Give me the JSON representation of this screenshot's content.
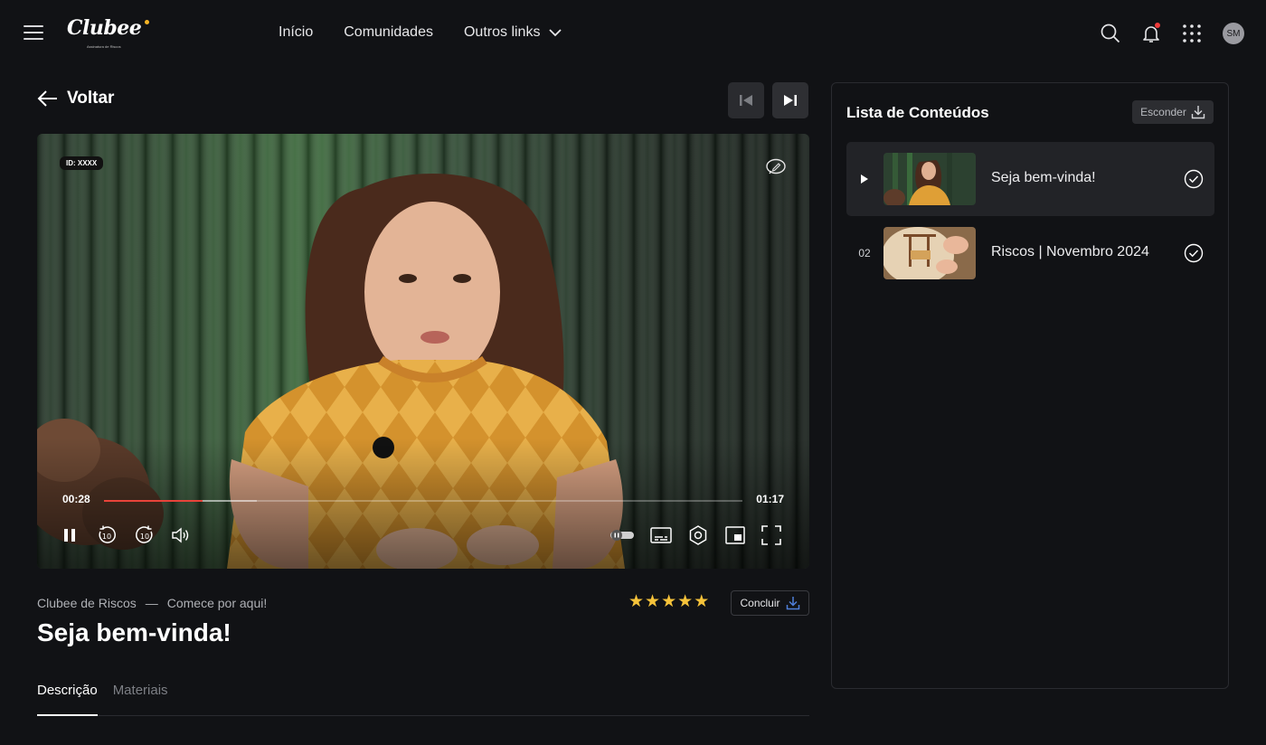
{
  "header": {
    "logo": "Clubee",
    "logo_sub": "Assinatura de Riscos",
    "nav": [
      {
        "label": "Início"
      },
      {
        "label": "Comunidades"
      },
      {
        "label": "Outros links"
      }
    ],
    "avatar_initials": "SM",
    "icons": [
      "search-icon",
      "bell-icon",
      "apps-grid-icon"
    ]
  },
  "back_label": "Voltar",
  "player": {
    "id_tag": "ID: XXXX",
    "current_time": "00:28",
    "total_time": "01:17",
    "progress": 0.155,
    "buffered": 0.24
  },
  "lesson": {
    "course": "Clubee de Riscos",
    "separator": "—",
    "module": "Comece por aqui!",
    "title": "Seja bem-vinda!",
    "rating": 5,
    "complete_label": "Concluir",
    "tabs": [
      {
        "label": "Descrição",
        "active": true
      },
      {
        "label": "Materiais",
        "active": false
      }
    ]
  },
  "sidebar": {
    "title": "Lista de Conteúdos",
    "hide_label": "Esconder",
    "items": [
      {
        "index": "",
        "title": "Seja bem-vinda!",
        "active": true,
        "completed": true
      },
      {
        "index": "02",
        "title": "Riscos | Novembro 2024",
        "active": false,
        "completed": true
      }
    ]
  },
  "colors": {
    "background": "#111215",
    "accent_progress": "#e8433a",
    "star": "#f6c33a",
    "notification": "#ef3b3b"
  }
}
